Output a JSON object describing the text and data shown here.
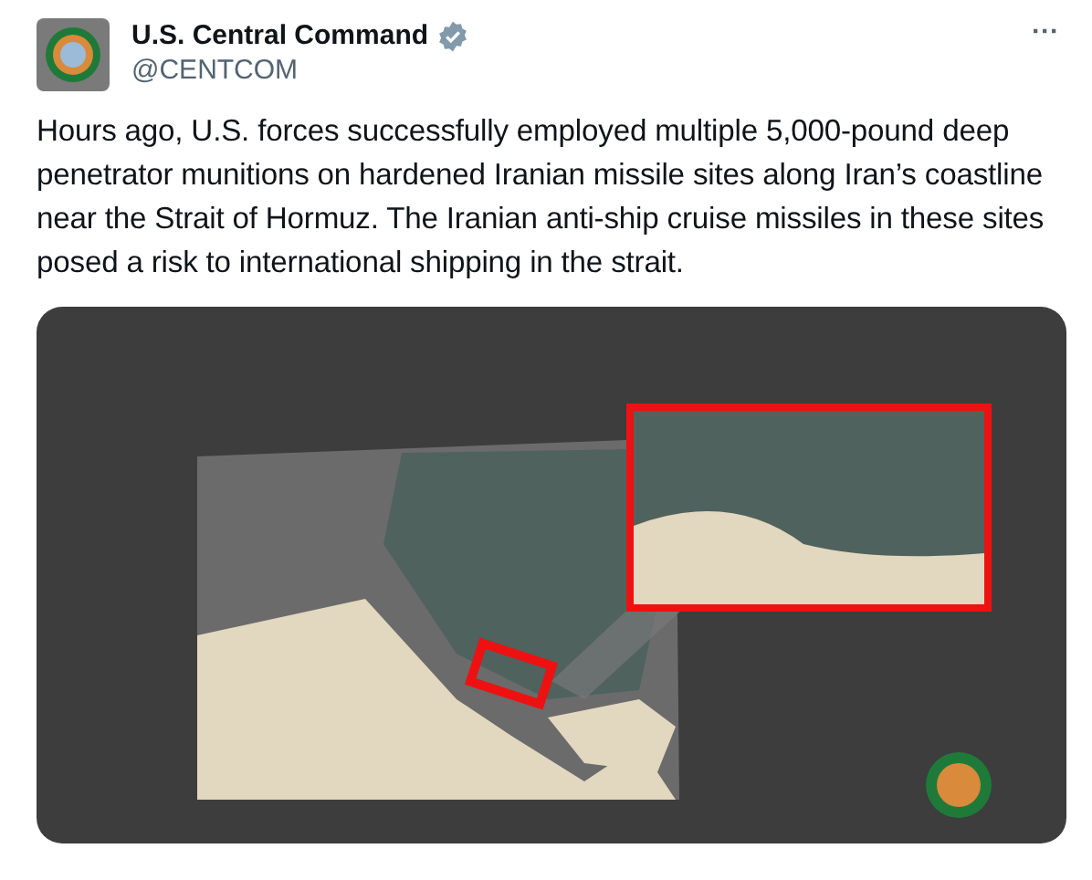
{
  "author": {
    "name": "U.S. Central Command",
    "verified": true,
    "handle": "@CENTCOM"
  },
  "more_menu": "···",
  "text": "Hours ago, U.S. forces successfully employed multiple 5,000-pound deep penetrator munitions on hardened Iranian missile sites along Iran’s coastline near the Strait of Hormuz. The Iranian anti-ship cruise missiles in these sites posed a risk to international shipping in the strait."
}
